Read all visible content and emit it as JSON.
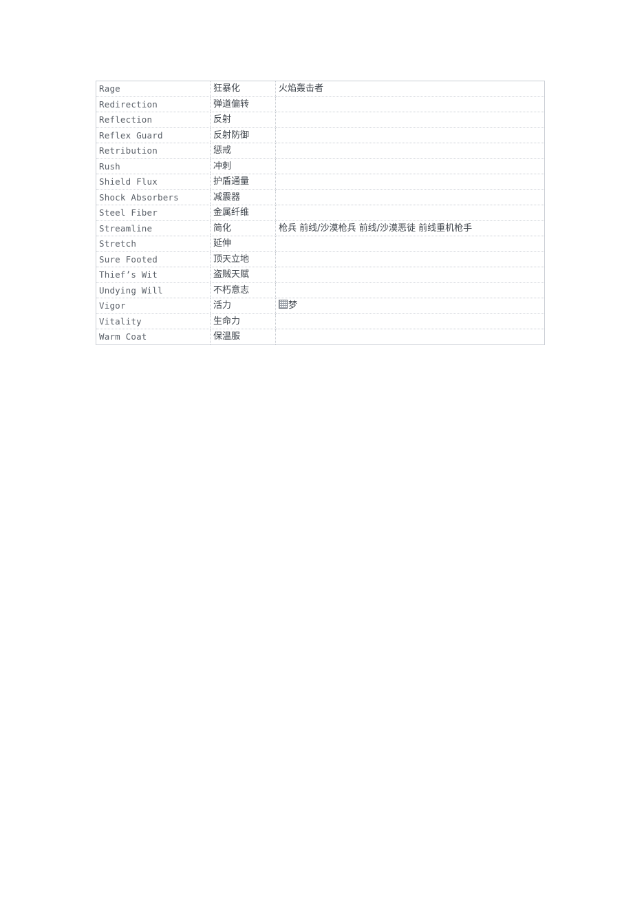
{
  "document": {
    "table": {
      "columns": [
        "english_name",
        "chinese_name",
        "notes"
      ],
      "rows": [
        {
          "english_name": "Rage",
          "chinese_name": "狂暴化",
          "notes": "火焰轰击者"
        },
        {
          "english_name": "Redirection",
          "chinese_name": "弹道偏转",
          "notes": ""
        },
        {
          "english_name": "Reflection",
          "chinese_name": "反射",
          "notes": ""
        },
        {
          "english_name": "Reflex Guard",
          "chinese_name": "反射防御",
          "notes": ""
        },
        {
          "english_name": "Retribution",
          "chinese_name": "惩戒",
          "notes": ""
        },
        {
          "english_name": "Rush",
          "chinese_name": "冲刺",
          "notes": ""
        },
        {
          "english_name": "Shield Flux",
          "chinese_name": "护盾通量",
          "notes": ""
        },
        {
          "english_name": "Shock Absorbers",
          "chinese_name": "减震器",
          "notes": ""
        },
        {
          "english_name": "Steel Fiber",
          "chinese_name": "金属纤维",
          "notes": ""
        },
        {
          "english_name": "Streamline",
          "chinese_name": "简化",
          "notes": "枪兵 前线/沙漠枪兵 前线/沙漠恶徒 前线重机枪手"
        },
        {
          "english_name": "Stretch",
          "chinese_name": "延伸",
          "notes": ""
        },
        {
          "english_name": "Sure Footed",
          "chinese_name": "顶天立地",
          "notes": ""
        },
        {
          "english_name": "Thief’s Wit",
          "chinese_name": "盗贼天赋",
          "notes": ""
        },
        {
          "english_name": "Undying Will",
          "chinese_name": "不朽意志",
          "notes": ""
        },
        {
          "english_name": "Vigor",
          "chinese_name": "活力",
          "notes": "梦",
          "notes_has_missing_glyph": true
        },
        {
          "english_name": "Vitality",
          "chinese_name": "生命力",
          "notes": ""
        },
        {
          "english_name": "Warm Coat",
          "chinese_name": "保温服",
          "notes": ""
        }
      ]
    },
    "colors": {
      "page_background": "#ffffff",
      "english_text": "#5a6068",
      "chinese_text": "#3f454c",
      "table_border": "#c9cdd4",
      "cell_divider": "#c8ccd3"
    }
  }
}
